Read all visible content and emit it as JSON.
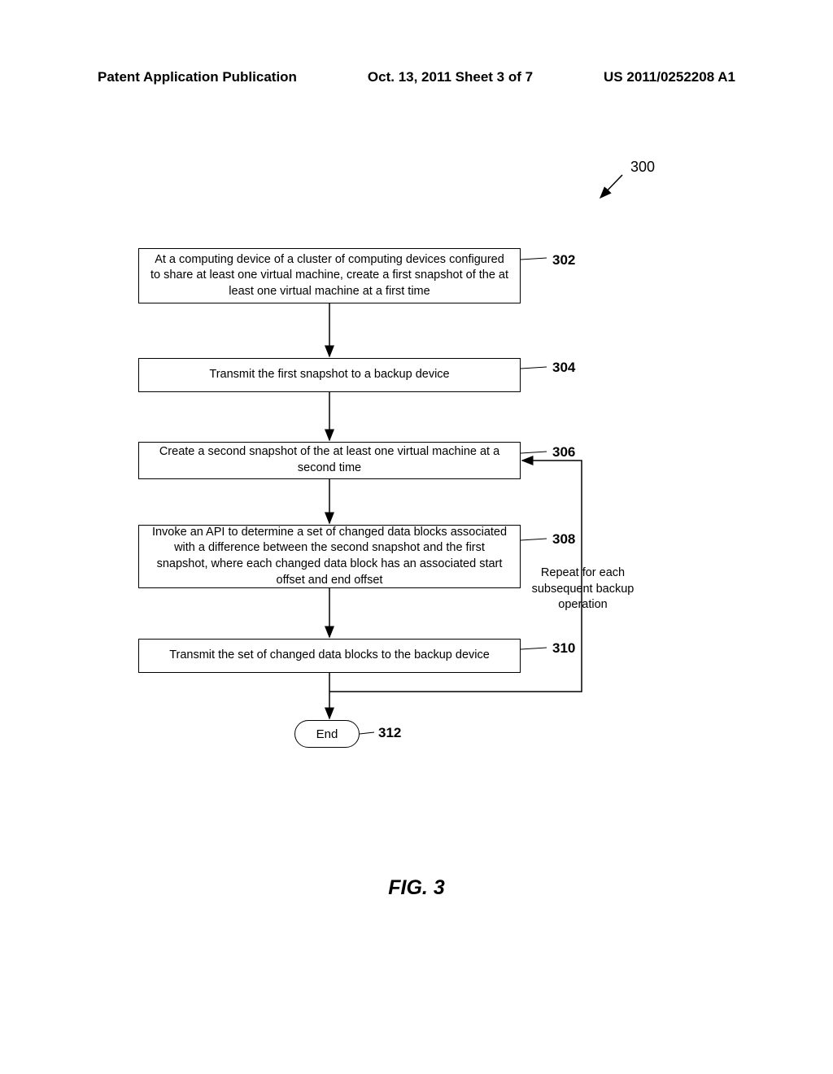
{
  "header": {
    "left": "Patent Application Publication",
    "center": "Oct. 13, 2011  Sheet 3 of 7",
    "right": "US 2011/0252208 A1"
  },
  "diagram": {
    "ref_number": "300",
    "steps": {
      "step302": {
        "label": "302",
        "text": "At a computing device of a cluster of computing devices configured to share at least one virtual machine, create a first snapshot of the at least one virtual machine at a first time"
      },
      "step304": {
        "label": "304",
        "text": "Transmit the first snapshot to a backup device"
      },
      "step306": {
        "label": "306",
        "text": "Create a second snapshot of the at least one virtual machine at a second time"
      },
      "step308": {
        "label": "308",
        "text": "Invoke an API to determine a set of changed data blocks associated with a difference between the second snapshot and the first snapshot, where each changed data block has an associated start offset and end offset"
      },
      "step310": {
        "label": "310",
        "text": "Transmit the set of changed data blocks to the backup device"
      },
      "end": {
        "label": "312",
        "text": "End"
      }
    },
    "repeat_label": "Repeat for each subsequent backup operation"
  },
  "figure_caption": "FIG. 3"
}
